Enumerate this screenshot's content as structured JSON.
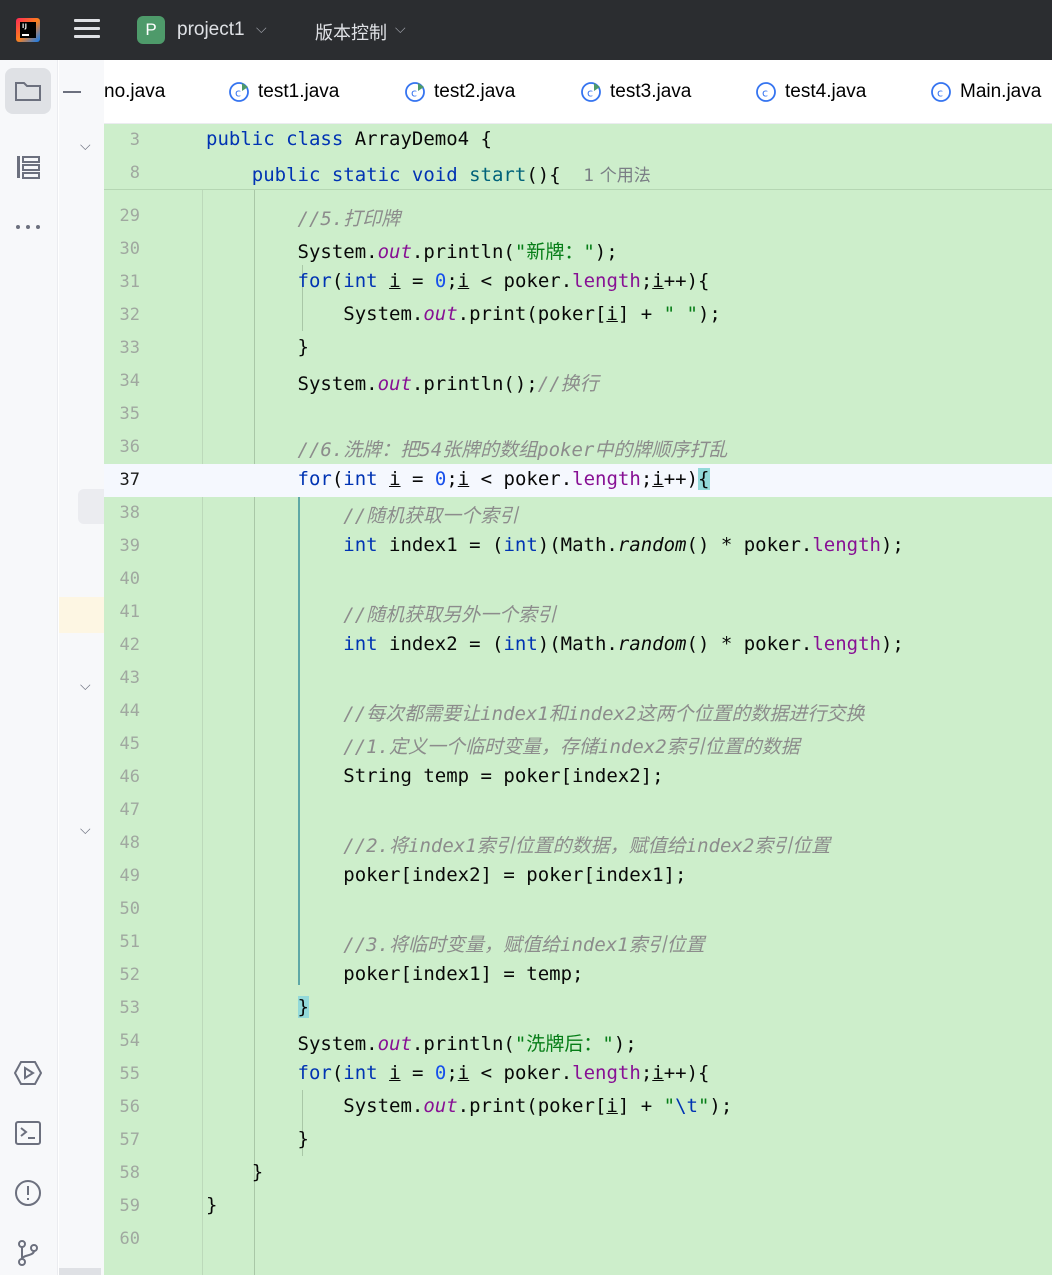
{
  "titlebar": {
    "project_badge": "P",
    "project_name": "project1",
    "vcs_label": "版本控制",
    "chevron": "⌵"
  },
  "tabs": [
    {
      "label": "no.java",
      "icon": "none"
    },
    {
      "label": "test1.java",
      "icon": "class-runnable-icon"
    },
    {
      "label": "test2.java",
      "icon": "class-runnable-icon"
    },
    {
      "label": "test3.java",
      "icon": "class-runnable-icon"
    },
    {
      "label": "test4.java",
      "icon": "class-icon"
    },
    {
      "label": "Main.java",
      "icon": "class-icon"
    }
  ],
  "sticky": {
    "lines": [
      {
        "num": "3",
        "code": "public class ArrayDemo4 {"
      },
      {
        "num": "8",
        "code": "public static void start(){",
        "hint": "1 个用法"
      }
    ]
  },
  "editor": {
    "current_line": "37",
    "lines": [
      {
        "num": "29",
        "text": "//5.打印牌"
      },
      {
        "num": "30",
        "text": "System.out.println(\"新牌：\");"
      },
      {
        "num": "31",
        "text": "for(int i = 0;i < poker.length;i++){"
      },
      {
        "num": "32",
        "text": "System.out.print(poker[i] + \" \");"
      },
      {
        "num": "33",
        "text": "}"
      },
      {
        "num": "34",
        "text": "System.out.println();//换行"
      },
      {
        "num": "35",
        "text": ""
      },
      {
        "num": "36",
        "text": "//6.洗牌：把54张牌的数组poker中的牌顺序打乱"
      },
      {
        "num": "37",
        "text": "for(int i = 0;i < poker.length;i++){"
      },
      {
        "num": "38",
        "text": "//随机获取一个索引"
      },
      {
        "num": "39",
        "text": "int index1 = (int)(Math.random() * poker.length);"
      },
      {
        "num": "40",
        "text": ""
      },
      {
        "num": "41",
        "text": "//随机获取另外一个索引"
      },
      {
        "num": "42",
        "text": "int index2 = (int)(Math.random() * poker.length);"
      },
      {
        "num": "43",
        "text": ""
      },
      {
        "num": "44",
        "text": "//每次都需要让index1和index2这两个位置的数据进行交换"
      },
      {
        "num": "45",
        "text": "//1.定义一个临时变量，存储index2索引位置的数据"
      },
      {
        "num": "46",
        "text": "String temp = poker[index2];"
      },
      {
        "num": "47",
        "text": ""
      },
      {
        "num": "48",
        "text": "//2.将index1索引位置的数据，赋值给index2索引位置"
      },
      {
        "num": "49",
        "text": "poker[index2] = poker[index1];"
      },
      {
        "num": "50",
        "text": ""
      },
      {
        "num": "51",
        "text": "//3.将临时变量，赋值给index1索引位置"
      },
      {
        "num": "52",
        "text": "poker[index1] = temp;"
      },
      {
        "num": "53",
        "text": "}"
      },
      {
        "num": "54",
        "text": "System.out.println(\"洗牌后：\");"
      },
      {
        "num": "55",
        "text": "for(int i = 0;i < poker.length;i++){"
      },
      {
        "num": "56",
        "text": "System.out.print(poker[i] + \"\\t\");"
      },
      {
        "num": "57",
        "text": "}"
      },
      {
        "num": "58",
        "text": "}"
      },
      {
        "num": "59",
        "text": "}"
      },
      {
        "num": "60",
        "text": ""
      }
    ]
  },
  "toolstrip": {
    "icons": [
      "folder-icon",
      "structure-icon",
      "more-icon",
      "services-icon",
      "terminal-icon",
      "problems-icon",
      "git-icon"
    ]
  },
  "colors": {
    "titlebar": "#2b2d30",
    "editor_bg": "#cdeecb",
    "keyword": "#0033b3",
    "comment": "#8c8c8c",
    "string": "#067d17",
    "number": "#1750eb",
    "field": "#871094"
  }
}
